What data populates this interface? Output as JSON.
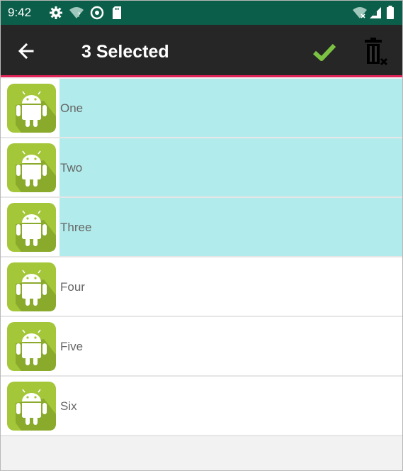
{
  "status_bar": {
    "time": "9:42",
    "icons": [
      "settings-icon",
      "wifi-question-icon",
      "do-not-disturb-icon",
      "sd-card-icon",
      "wifi-signal-icon",
      "cell-signal-icon",
      "battery-icon"
    ],
    "color": "#0b5e49"
  },
  "toolbar": {
    "title": "3 Selected",
    "back_icon": "arrow-back-icon",
    "confirm_icon": "check-icon",
    "delete_icon": "trash-clear-icon",
    "background": "#262626",
    "accent": "#e2245a",
    "check_color": "#7cc242"
  },
  "list": {
    "selected_color": "#b2ebeb",
    "icon": "android-app-icon",
    "items": [
      {
        "label": "One",
        "selected": true
      },
      {
        "label": "Two",
        "selected": true
      },
      {
        "label": "Three",
        "selected": true
      },
      {
        "label": "Four",
        "selected": false
      },
      {
        "label": "Five",
        "selected": false
      },
      {
        "label": "Six",
        "selected": false
      }
    ]
  }
}
